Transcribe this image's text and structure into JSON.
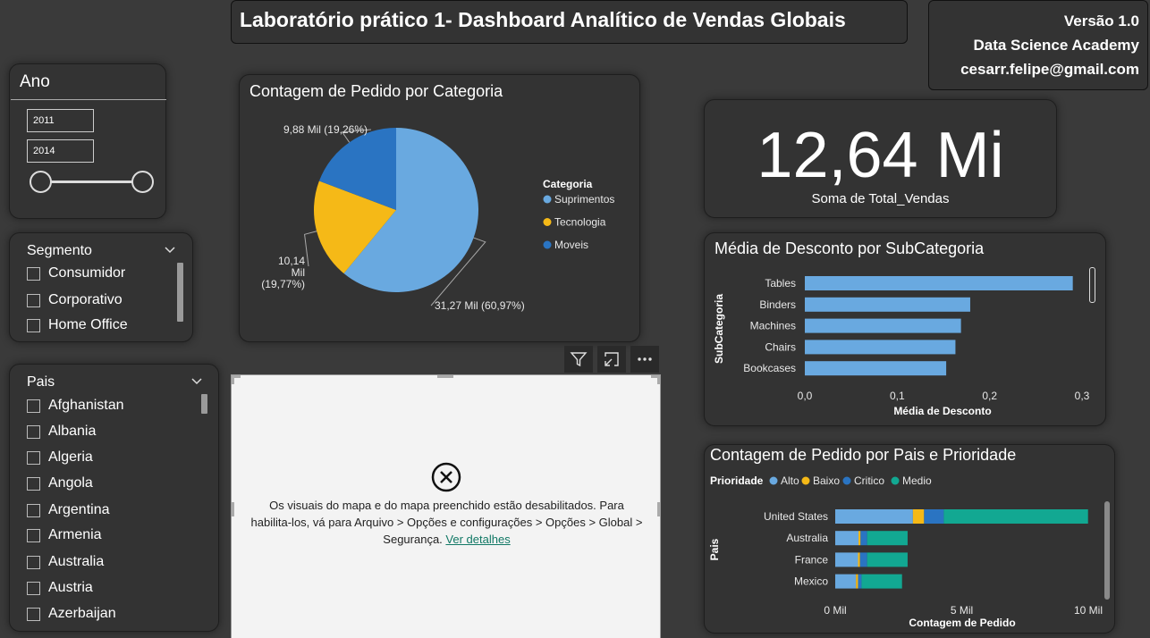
{
  "header": {
    "title": "Laboratório prático 1- Dashboard Analítico de Vendas Globais",
    "version": "Versão 1.0",
    "org": "Data Science Academy",
    "email": "cesarr.felipe@gmail.com"
  },
  "ano": {
    "title": "Ano",
    "start": "2011",
    "end": "2014"
  },
  "segmento": {
    "title": "Segmento",
    "items": [
      "Consumidor",
      "Corporativo",
      "Home Office"
    ]
  },
  "pais": {
    "title": "Pais",
    "items": [
      "Afghanistan",
      "Albania",
      "Algeria",
      "Angola",
      "Argentina",
      "Armenia",
      "Australia",
      "Austria",
      "Azerbaijan"
    ]
  },
  "kpi": {
    "value": "12,64 Mi",
    "label": "Soma de Total_Vendas"
  },
  "map": {
    "message": "Os visuais do mapa e do mapa preenchido estão desabilitados. Para habilita-los, vá para Arquivo > Opções e configurações > Opções > Global > Segurança.",
    "link": "Ver detalhes"
  },
  "colors": {
    "light_blue": "#69a9e0",
    "yellow": "#f5b917",
    "blue": "#2a74c2",
    "teal": "#12a892",
    "card": "#333333"
  },
  "chart_data": [
    {
      "type": "pie",
      "title": "Contagem de Pedido por Categoria",
      "legend_title": "Categoria",
      "legend_position": "right",
      "categories": [
        "Suprimentos",
        "Tecnologia",
        "Moveis"
      ],
      "values": [
        31.27,
        10.14,
        9.88
      ],
      "labels": [
        "31,27 Mil (60,97%)",
        "10,14 Mil (19,77%)",
        "9,88 Mil (19,26%)"
      ],
      "colors": [
        "#69a9e0",
        "#f5b917",
        "#2a74c2"
      ]
    },
    {
      "type": "bar",
      "orientation": "horizontal",
      "title": "Média de Desconto por SubCategoria",
      "categories": [
        "Tables",
        "Binders",
        "Machines",
        "Chairs",
        "Bookcases"
      ],
      "values": [
        0.29,
        0.179,
        0.169,
        0.163,
        0.153
      ],
      "xlabel": "Média de Desconto",
      "ylabel": "SubCategoria",
      "xlim": [
        0,
        0.3
      ],
      "xticks": [
        "0,0",
        "0,1",
        "0,2",
        "0,3"
      ],
      "color": "#69a9e0"
    },
    {
      "type": "bar",
      "orientation": "horizontal",
      "stacked": true,
      "title": "Contagem de Pedido por Pais e Prioridade",
      "legend_title": "Prioridade",
      "legend_position": "top-left",
      "categories": [
        "United States",
        "Australia",
        "France",
        "Mexico"
      ],
      "series": [
        {
          "name": "Alto",
          "values": [
            3.07,
            0.92,
            0.9,
            0.82
          ]
        },
        {
          "name": "Baixo",
          "values": [
            0.44,
            0.08,
            0.08,
            0.08
          ]
        },
        {
          "name": "Critico",
          "values": [
            0.78,
            0.26,
            0.28,
            0.14
          ]
        },
        {
          "name": "Medio",
          "values": [
            5.7,
            1.6,
            1.6,
            1.6
          ]
        }
      ],
      "xlabel": "Contagem de Pedido",
      "ylabel": "Pais",
      "xlim": [
        0,
        10
      ],
      "xticks": [
        "0 Mil",
        "5 Mil",
        "10 Mil"
      ],
      "colors": [
        "#69a9e0",
        "#f5b917",
        "#2a74c2",
        "#12a892"
      ]
    }
  ]
}
